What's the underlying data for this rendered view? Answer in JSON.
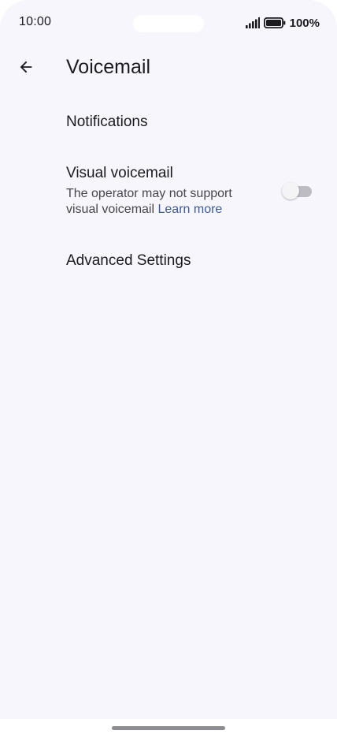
{
  "status_bar": {
    "time": "10:00",
    "battery": "100%",
    "signal_icon": "signal-icon",
    "battery_icon": "battery-icon"
  },
  "header": {
    "back_icon": "arrow-back-icon",
    "title": "Voicemail"
  },
  "settings": {
    "notifications": {
      "title": "Notifications"
    },
    "visual_voicemail": {
      "title": "Visual voicemail",
      "summary": "The operator may not support visual voicemail",
      "link": "Learn more",
      "enabled": false
    },
    "advanced": {
      "title": "Advanced Settings"
    }
  },
  "colors": {
    "background": "#f7f6fc",
    "link": "#3d5a99",
    "toggle_off_track": "#bdbcc2"
  }
}
